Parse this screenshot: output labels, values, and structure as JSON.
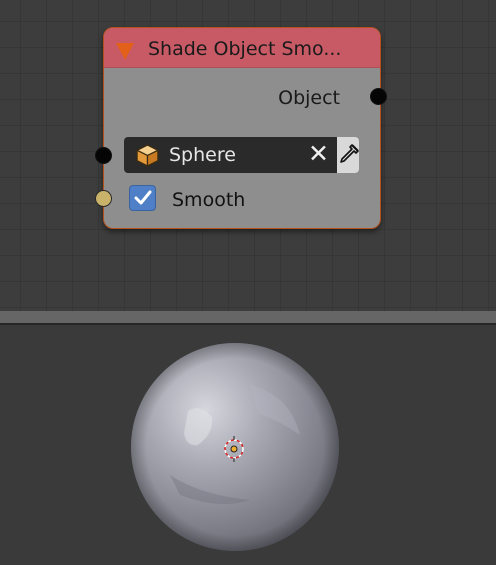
{
  "node": {
    "title": "Shade Object Smo...",
    "output_label": "Object",
    "object_field": {
      "value": "Sphere",
      "icon": "cube-icon"
    },
    "smooth": {
      "label": "Smooth",
      "checked": true
    }
  },
  "icons": {
    "collapse": "chevron-down-icon",
    "clear": "close-icon",
    "eyedropper": "eyedropper-icon"
  },
  "colors": {
    "node_header": "#c85a66",
    "node_body": "#8e8e8e",
    "node_border": "#b3501c",
    "collapse_arrow": "#e2601a",
    "object_socket": "#050505",
    "boolean_socket": "#c9b36a",
    "checkbox": "#4f7fc7",
    "grid_background": "#3d3d3d",
    "viewport_background": "#3a3a3a"
  },
  "viewport": {
    "object": "sphere",
    "shading": "smooth"
  }
}
